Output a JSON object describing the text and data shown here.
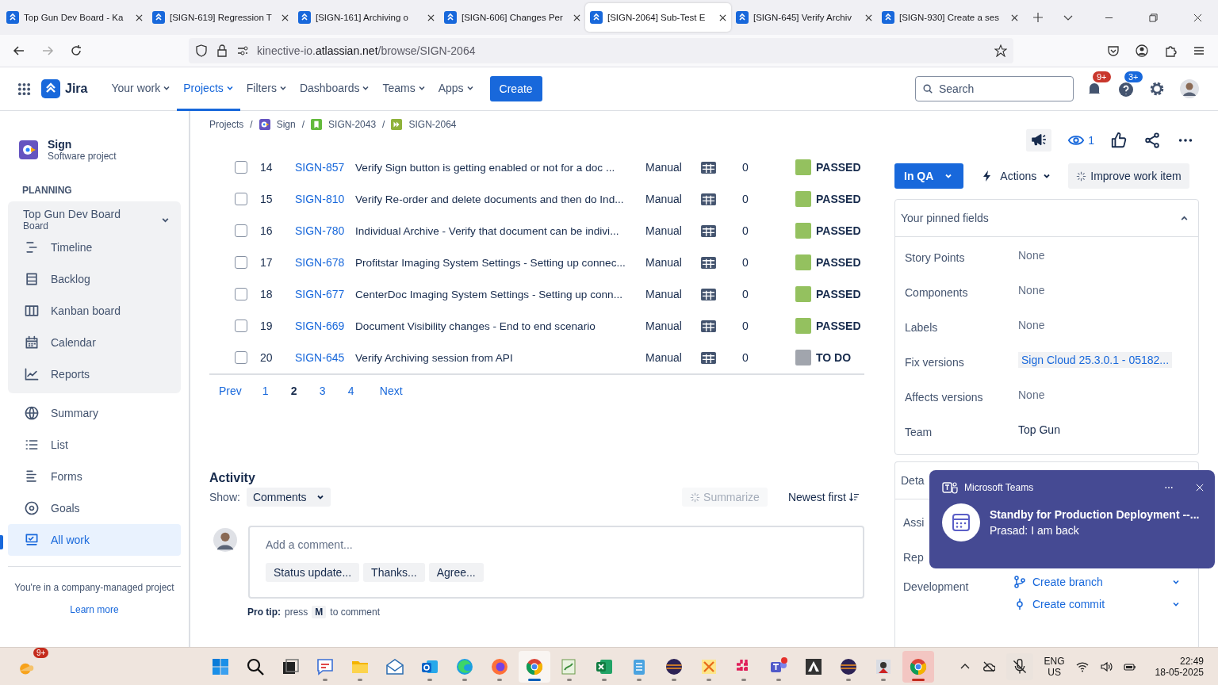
{
  "browser": {
    "tabs": [
      {
        "title": "Top Gun Dev Board - Ka",
        "selected": false
      },
      {
        "title": "[SIGN-619] Regression T",
        "selected": false
      },
      {
        "title": "[SIGN-161] Archiving o",
        "selected": false
      },
      {
        "title": "[SIGN-606] Changes Per",
        "selected": false
      },
      {
        "title": "[SIGN-2064] Sub-Test E",
        "selected": true
      },
      {
        "title": "[SIGN-645] Verify Archiv",
        "selected": false
      },
      {
        "title": "[SIGN-930] Create a ses",
        "selected": false
      }
    ],
    "url": {
      "subdomain": "kinective-io.",
      "domain": "atlassian.net",
      "path": "/browse/SIGN-2064"
    }
  },
  "nav": {
    "logo": "Jira",
    "items": [
      {
        "label": "Your work",
        "selected": false
      },
      {
        "label": "Projects",
        "selected": true
      },
      {
        "label": "Filters",
        "selected": false
      },
      {
        "label": "Dashboards",
        "selected": false
      },
      {
        "label": "Teams",
        "selected": false
      },
      {
        "label": "Apps",
        "selected": false
      }
    ],
    "create": "Create",
    "search_placeholder": "Search",
    "notifications_badge": "9+",
    "help_badge": "3+"
  },
  "sidebar": {
    "project": {
      "name": "Sign",
      "type": "Software project"
    },
    "section": "PLANNING",
    "board": {
      "name": "Top Gun Dev Board",
      "subtitle": "Board",
      "expanded": true,
      "children": [
        {
          "label": "Timeline",
          "selected": false
        },
        {
          "label": "Backlog",
          "selected": false
        },
        {
          "label": "Kanban board",
          "selected": false
        },
        {
          "label": "Calendar",
          "selected": false
        },
        {
          "label": "Reports",
          "selected": false
        }
      ]
    },
    "items": [
      {
        "label": "Summary",
        "selected": false
      },
      {
        "label": "List",
        "selected": false
      },
      {
        "label": "Forms",
        "selected": false
      },
      {
        "label": "Goals",
        "selected": false
      },
      {
        "label": "All work",
        "selected": true
      }
    ],
    "footer": "You're in a company-managed project",
    "learn_more": "Learn more"
  },
  "breadcrumb_separator": "/",
  "breadcrumbs": [
    {
      "label": "Projects",
      "kind": "text"
    },
    {
      "label": "Sign",
      "kind": "project"
    },
    {
      "label": "SIGN-2043",
      "kind": "story"
    },
    {
      "label": "SIGN-2064",
      "kind": "subtask"
    }
  ],
  "table": {
    "rows": [
      {
        "checked": false,
        "number": "14",
        "key": "SIGN-857",
        "summary": "Verify Sign button is getting enabled or not for a doc ...",
        "type": "Manual",
        "count": "0",
        "status": "PASSED",
        "color": "#94c15f"
      },
      {
        "checked": false,
        "number": "15",
        "key": "SIGN-810",
        "summary": "Verify Re-order and delete documents and then do Ind...",
        "type": "Manual",
        "count": "0",
        "status": "PASSED",
        "color": "#94c15f"
      },
      {
        "checked": false,
        "number": "16",
        "key": "SIGN-780",
        "summary": "Individual Archive - Verify that document can be indivi...",
        "type": "Manual",
        "count": "0",
        "status": "PASSED",
        "color": "#94c15f"
      },
      {
        "checked": false,
        "number": "17",
        "key": "SIGN-678",
        "summary": "Profitstar Imaging System Settings - Setting up connec...",
        "type": "Manual",
        "count": "0",
        "status": "PASSED",
        "color": "#94c15f"
      },
      {
        "checked": false,
        "number": "18",
        "key": "SIGN-677",
        "summary": "CenterDoc Imaging System Settings - Setting up conn...",
        "type": "Manual",
        "count": "0",
        "status": "PASSED",
        "color": "#94c15f"
      },
      {
        "checked": false,
        "number": "19",
        "key": "SIGN-669",
        "summary": "Document Visibility changes - End to end scenario",
        "type": "Manual",
        "count": "0",
        "status": "PASSED",
        "color": "#94c15f"
      },
      {
        "checked": false,
        "number": "20",
        "key": "SIGN-645",
        "summary": "Verify Archiving session from API",
        "type": "Manual",
        "count": "0",
        "status": "TO DO",
        "color": "#a1a5ad"
      }
    ]
  },
  "pagination": {
    "prev": "Prev",
    "pages": [
      {
        "label": "1",
        "selected": false
      },
      {
        "label": "2",
        "selected": true
      },
      {
        "label": "3",
        "selected": false
      },
      {
        "label": "4",
        "selected": false
      }
    ],
    "next": "Next"
  },
  "activity": {
    "title": "Activity",
    "show_label": "Show:",
    "filter": "Comments",
    "summarize": {
      "label": "Summarize",
      "disabled": true
    },
    "sort": "Newest first",
    "comment_placeholder": "Add a comment...",
    "quick_replies": [
      "Status update...",
      "Thanks...",
      "Agree..."
    ],
    "pro_tip": {
      "label": "Pro tip:",
      "before": "press",
      "key": "M",
      "after": "to comment"
    }
  },
  "issue": {
    "watchers": "1",
    "status": "In QA",
    "actions": "Actions",
    "improve": "Improve work item",
    "pinned": {
      "title": "Your pinned fields",
      "expanded": true,
      "fields": [
        {
          "label": "Story Points",
          "value": "None",
          "kind": "empty"
        },
        {
          "label": "Components",
          "value": "None",
          "kind": "empty"
        },
        {
          "label": "Labels",
          "value": "None",
          "kind": "empty"
        },
        {
          "label": "Fix versions",
          "value": "Sign Cloud 25.3.0.1 - 05182...",
          "kind": "tag"
        },
        {
          "label": "Affects versions",
          "value": "None",
          "kind": "empty"
        },
        {
          "label": "Team",
          "value": "Top Gun",
          "kind": "value"
        }
      ]
    },
    "details": {
      "title": "Deta",
      "fields": [
        "Assi",
        "Rep"
      ],
      "development": {
        "label": "Development",
        "links": [
          "Create branch",
          "Create commit"
        ]
      }
    }
  },
  "toast": {
    "app": "Microsoft Teams",
    "title": "Standby for Production Deployment --...",
    "message": "Prasad: I am back"
  },
  "taskbar": {
    "weather_badge": "9+",
    "apps": [
      {
        "running": false,
        "active": false,
        "attention": false
      },
      {
        "running": false,
        "active": false,
        "attention": false
      },
      {
        "running": false,
        "active": false,
        "attention": false
      },
      {
        "running": true,
        "active": false,
        "attention": false
      },
      {
        "running": true,
        "active": false,
        "attention": false
      },
      {
        "running": false,
        "active": false,
        "attention": false
      },
      {
        "running": true,
        "active": false,
        "attention": false
      },
      {
        "running": true,
        "active": false,
        "attention": false
      },
      {
        "running": true,
        "active": false,
        "attention": false
      },
      {
        "running": true,
        "active": true,
        "attention": false
      },
      {
        "running": true,
        "active": false,
        "attention": false
      },
      {
        "running": true,
        "active": false,
        "attention": false
      },
      {
        "running": true,
        "active": false,
        "attention": false
      },
      {
        "running": true,
        "active": false,
        "attention": false
      },
      {
        "running": true,
        "active": false,
        "attention": false
      },
      {
        "running": true,
        "active": false,
        "attention": false
      },
      {
        "running": true,
        "active": false,
        "attention": false
      },
      {
        "running": false,
        "active": false,
        "attention": false
      },
      {
        "running": true,
        "active": false,
        "attention": false
      },
      {
        "running": true,
        "active": false,
        "attention": false
      },
      {
        "running": true,
        "active": false,
        "attention": true
      }
    ],
    "language": "ENG",
    "region": "US",
    "time": "22:49",
    "date": "18-05-2025"
  }
}
